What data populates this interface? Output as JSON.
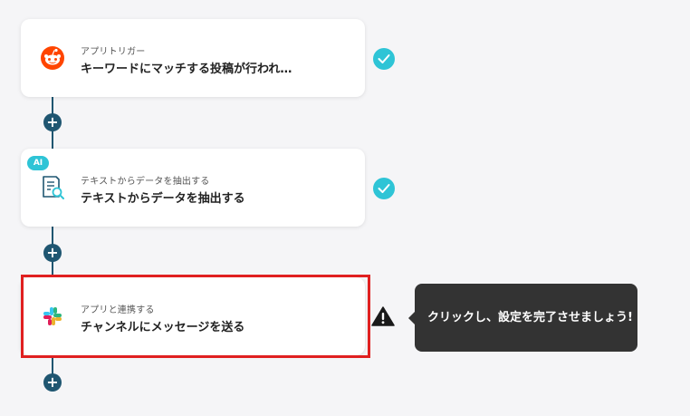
{
  "steps": [
    {
      "subtitle": "アプリトリガー",
      "title": "キーワードにマッチする投稿が行われ…",
      "icon": "reddit-icon",
      "status": "completed"
    },
    {
      "badge": "AI",
      "subtitle": "テキストからデータを抽出する",
      "title": "テキストからデータを抽出する",
      "icon": "document-search-icon",
      "status": "completed"
    },
    {
      "subtitle": "アプリと連携する",
      "title": "チャンネルにメッセージを送る",
      "icon": "slack-icon",
      "status": "warning"
    }
  ],
  "add_step_label": "+",
  "tooltip": {
    "text": "クリックし、設定を完了させましょう!"
  },
  "colors": {
    "accent": "#2ec4d6",
    "connector": "#1f5671",
    "highlight": "#e02020",
    "tooltip_bg": "#333333",
    "reddit": "#ff4500"
  }
}
